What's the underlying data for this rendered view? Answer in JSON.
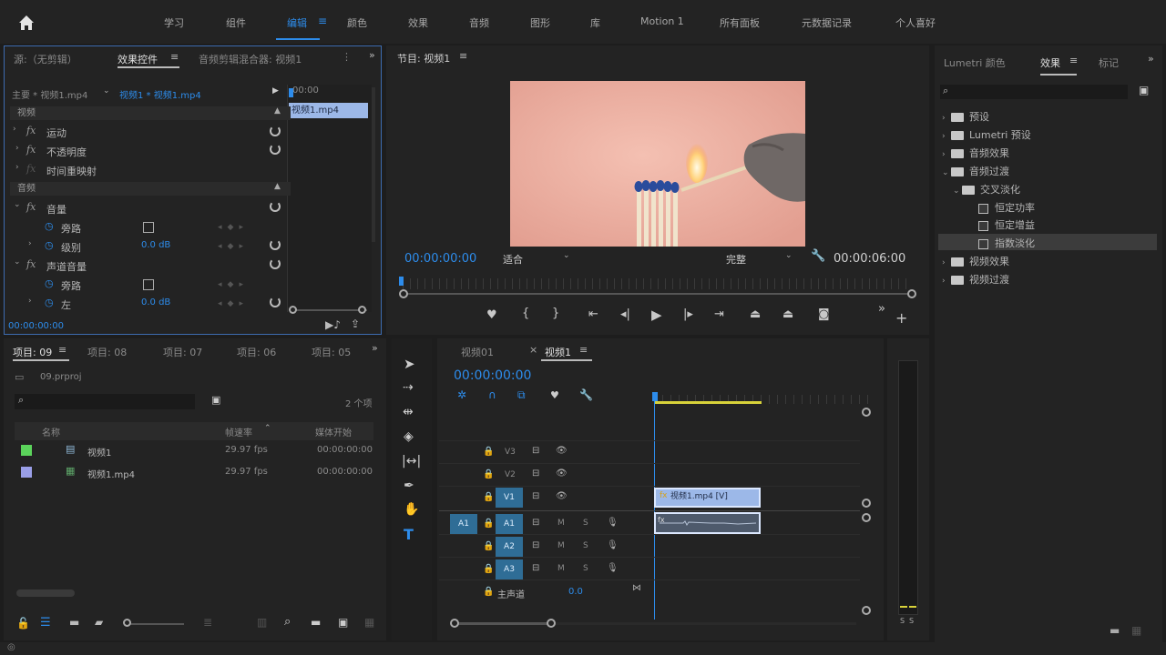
{
  "workspace_tabs": [
    "学习",
    "组件",
    "编辑",
    "颜色",
    "效果",
    "音频",
    "图形",
    "库",
    "Motion 1",
    "所有面板",
    "元数据记录",
    "个人喜好"
  ],
  "workspace_active": "编辑",
  "source_panel": {
    "tabs": [
      "源:（无剪辑）",
      "效果控件",
      "音频剪辑混合器: 视频1"
    ],
    "active_tab": "效果控件",
    "master_label": "主要 * 视频1.mp4",
    "sequence_clip_label": "视频1 * 视频1.mp4",
    "ruler_time": "00:00",
    "clip_bar_label": "视频1.mp4",
    "video_header": "视频",
    "audio_header": "音频",
    "motion": "运动",
    "opacity": "不透明度",
    "time_remap": "时间重映射",
    "volume": "音量",
    "bypass": "旁路",
    "level": "级别",
    "level_value": "0.0 dB",
    "channel_volume": "声道音量",
    "bypass2": "旁路",
    "left": "左",
    "left_value": "0.0 dB",
    "timecode": "00:00:00:00"
  },
  "program_monitor": {
    "title": "节目: 视频1",
    "timecode_current": "00:00:00:00",
    "fit_option": "适合",
    "quality_option": "完整",
    "timecode_duration": "00:00:06:00"
  },
  "effects_panel": {
    "tabs": [
      "Lumetri 颜色",
      "效果",
      "标记"
    ],
    "active_tab": "效果",
    "tree": [
      {
        "label": "预设",
        "level": 0,
        "type": "folder-special",
        "open": false
      },
      {
        "label": "Lumetri 预设",
        "level": 0,
        "type": "folder-special",
        "open": false
      },
      {
        "label": "音频效果",
        "level": 0,
        "type": "folder",
        "open": false
      },
      {
        "label": "音频过渡",
        "level": 0,
        "type": "folder",
        "open": true
      },
      {
        "label": "交叉淡化",
        "level": 1,
        "type": "folder",
        "open": true
      },
      {
        "label": "恒定功率",
        "level": 2,
        "type": "effect",
        "open": false
      },
      {
        "label": "恒定增益",
        "level": 2,
        "type": "effect",
        "open": false
      },
      {
        "label": "指数淡化",
        "level": 2,
        "type": "effect",
        "open": false
      },
      {
        "label": "视频效果",
        "level": 0,
        "type": "folder",
        "open": false
      },
      {
        "label": "视频过渡",
        "level": 0,
        "type": "folder",
        "open": false
      }
    ],
    "selected": "指数淡化"
  },
  "project_panel": {
    "tabs": [
      "项目: 09",
      "项目: 08",
      "项目: 07",
      "项目: 06",
      "项目: 05"
    ],
    "active_tab": "项目: 09",
    "file_name": "09.prproj",
    "item_count": "2 个项",
    "columns": [
      "名称",
      "帧速率",
      "媒体开始"
    ],
    "rows": [
      {
        "color": "#5bd35b",
        "name": "视频1",
        "fps": "29.97 fps",
        "start": "00:00:00:00",
        "icon": "sequence"
      },
      {
        "color": "#9a9fe8",
        "name": "视频1.mp4",
        "fps": "29.97 fps",
        "start": "00:00:00:00",
        "icon": "clip"
      }
    ]
  },
  "timeline": {
    "tabs": [
      "视频01",
      "视频1"
    ],
    "active_tab": "视频1",
    "timecode": "00:00:00:00",
    "tracks": [
      {
        "name": "V3"
      },
      {
        "name": "V2"
      },
      {
        "name": "V1"
      },
      {
        "name": "A1"
      },
      {
        "name": "A2"
      },
      {
        "name": "A3"
      }
    ],
    "source_patch": "A1",
    "master_label": "主声道",
    "master_value": "0.0",
    "mute_label": "M",
    "solo_label": "S",
    "video_clip_label": "视频1.mp4 [V]"
  },
  "audio_meter": {
    "labels": [
      "S",
      "S"
    ]
  },
  "colors": {
    "accent": "#2d8ceb",
    "panel_bg": "#232323",
    "track_target": "#2f6d96",
    "clip_video": "#9cb8e8",
    "playhead": "#2d8ceb"
  }
}
